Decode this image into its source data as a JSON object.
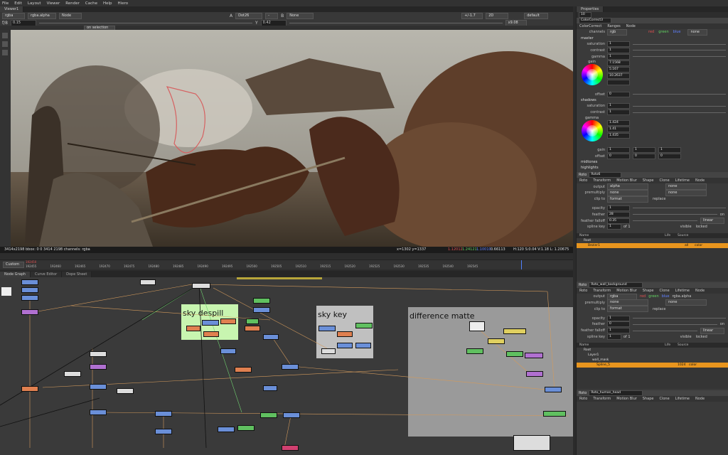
{
  "menu": [
    "File",
    "Edit",
    "Layout",
    "Viewer",
    "Render",
    "Cache",
    "Help",
    "Hiero"
  ],
  "viewer_tab": "Viewer1",
  "properties_tab": "Properties",
  "viewer_toolbar": {
    "channels": "rgba",
    "alpha": "rgba.alpha",
    "node": "Node",
    "a_input": "A",
    "dot_input": "Dot26",
    "b_input": "B",
    "b_none": "None",
    "frame_mode": "+/-1.7",
    "view_mode": "2D",
    "lut": "default",
    "zoom": "x9.08",
    "gain": "0.15",
    "gamma": "0.42",
    "roi_mode": "on selection"
  },
  "viewer_info": {
    "left": "3414x2198 bbox: 0 0 3414 2198 channels: rgba",
    "coords": "x=1302 y=1337",
    "r": "1.12012",
    "g": "1.24121",
    "b": "1.10010",
    "a": "0.66113",
    "hsv": "H:120 S:0.04 V:1.18  L: 1.20675"
  },
  "timeline": {
    "mode": "Custom",
    "current": "192450",
    "ticks": [
      "192455",
      "192460",
      "192465",
      "192470",
      "192475",
      "192480",
      "192485",
      "192490",
      "192495",
      "192500",
      "192505",
      "192510",
      "192515",
      "192520",
      "192525",
      "192530",
      "192535",
      "192540",
      "192545"
    ]
  },
  "graph_tabs": [
    "Node Graph",
    "Curve Editor",
    "Dope Sheet"
  ],
  "backdrops": {
    "sky_despill": "sky despill",
    "sky_key": "sky key",
    "difference_matte": "difference matte"
  },
  "colorcorrect": {
    "name": "ColorCorrect3",
    "tabs": [
      "ColorCorrect",
      "Ranges",
      "Node"
    ],
    "channels": "rgb",
    "channel_toggles": [
      "red",
      "green",
      "blue",
      "none"
    ],
    "master_label": "master",
    "master": [
      {
        "label": "saturation",
        "value": "1"
      },
      {
        "label": "contrast",
        "value": "1"
      },
      {
        "label": "gamma",
        "value": "1"
      },
      {
        "label": "gain",
        "value": ""
      }
    ],
    "master_gain_values": [
      "7.1568",
      "5.167",
      "10.2637",
      ""
    ],
    "offset_label": "offset",
    "offset_value": "0",
    "shadows_label": "shadows",
    "shadows": [
      {
        "label": "saturation",
        "value": "1"
      },
      {
        "label": "contrast",
        "value": "1"
      },
      {
        "label": "gamma",
        "value": ""
      }
    ],
    "shadow_values": [
      "1.424",
      "1.41",
      "1.435"
    ],
    "shadow_gain": {
      "label": "gain",
      "values": [
        "1",
        "1",
        "1"
      ]
    },
    "shadow_offset": {
      "label": "offset",
      "values": [
        "0",
        "0",
        "0"
      ]
    },
    "midtones_label": "midtones",
    "highlights_label": "highlights"
  },
  "roto1": {
    "name": "Roto6",
    "tabs": [
      "Roto",
      "Transform",
      "Motion Blur",
      "Shape",
      "Clone",
      "Lifetime",
      "Node"
    ],
    "output": "alpha",
    "output_mask": "none",
    "premultiply": "none",
    "premult_mask": "none",
    "clip_to": "format",
    "replace_label": "replace",
    "opacity": "1",
    "feather": "28",
    "feather_falloff": "0.35",
    "falloff_mode": "linear",
    "on_label": "on",
    "spline_key": "1",
    "spline_of": "of 1",
    "visible_label": "visible",
    "locked_label": "locked",
    "list_headers": [
      "Name",
      "",
      "",
      "",
      "",
      "",
      "Life",
      "Source"
    ],
    "list_rows": [
      {
        "name": "Root",
        "life": "",
        "source": ""
      },
      {
        "name": "Bezier1",
        "life": "all",
        "source": "color"
      }
    ]
  },
  "roto2": {
    "name": "Roto_wall_background",
    "tabs": [
      "Roto",
      "Transform",
      "Motion Blur",
      "Shape",
      "Clone",
      "Lifetime",
      "Node"
    ],
    "output": "rgba",
    "output_channels": [
      "red",
      "green",
      "blue",
      "rgba.alpha"
    ],
    "premultiply": "none",
    "premult_mask": "none",
    "clip_to": "format",
    "replace_label": "replace",
    "opacity": "1",
    "feather": "0",
    "feather_falloff": "1",
    "falloff_mode": "linear",
    "on_label": "on",
    "spline_key": "1",
    "spline_of": "of 1",
    "visible_label": "visible",
    "locked_label": "locked",
    "list_headers": [
      "Name",
      "",
      "",
      "",
      "",
      "",
      "Life",
      "Source"
    ],
    "list_rows": [
      {
        "name": "Root",
        "life": "",
        "source": ""
      },
      {
        "name": "Layer1",
        "life": "",
        "source": ""
      },
      {
        "name": "wall_mask",
        "life": "",
        "source": ""
      },
      {
        "name": "Spline_5",
        "life": "1024",
        "source": "color"
      }
    ]
  },
  "roto3": {
    "name": "Roto_human_head",
    "tabs": [
      "Roto",
      "Transform",
      "Motion Blur",
      "Shape",
      "Clone",
      "Lifetime",
      "Node"
    ]
  },
  "frame_field": "10",
  "colors": {
    "accent": "#e8951e",
    "selected_node": "#e8951e"
  }
}
